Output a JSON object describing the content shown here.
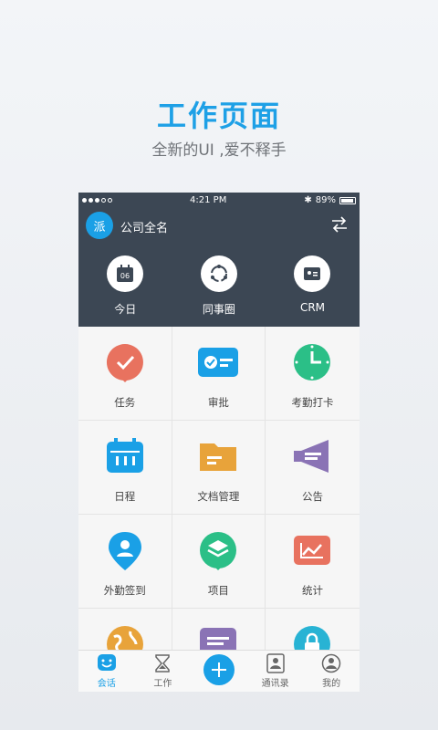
{
  "hero": {
    "title": "工作页面",
    "subtitle": "全新的UI ,爱不释手"
  },
  "status_bar": {
    "time": "4:21 PM",
    "battery": "89%"
  },
  "header": {
    "avatar_text": "派",
    "company": "公司全名"
  },
  "quick_actions": [
    {
      "label": "今日",
      "icon": "calendar-today-icon",
      "badge": "06"
    },
    {
      "label": "同事圈",
      "icon": "circle-refresh-icon"
    },
    {
      "label": "CRM",
      "icon": "contact-card-icon"
    }
  ],
  "grid": [
    {
      "label": "任务",
      "icon": "task-check-icon",
      "color": "#e8725f"
    },
    {
      "label": "审批",
      "icon": "approval-card-icon",
      "color": "#1aa0e6"
    },
    {
      "label": "考勤打卡",
      "icon": "clock-icon",
      "color": "#2bbf87"
    },
    {
      "label": "日程",
      "icon": "calendar-icon",
      "color": "#1aa0e6"
    },
    {
      "label": "文档管理",
      "icon": "folder-icon",
      "color": "#e8a33a"
    },
    {
      "label": "公告",
      "icon": "megaphone-icon",
      "color": "#8a73b5"
    },
    {
      "label": "外勤签到",
      "icon": "location-pin-icon",
      "color": "#1aa0e6"
    },
    {
      "label": "项目",
      "icon": "layers-icon",
      "color": "#2bbf87"
    },
    {
      "label": "统计",
      "icon": "chart-icon",
      "color": "#e8725f"
    },
    {
      "label": "",
      "icon": "globe-icon",
      "color": "#e8a33a"
    },
    {
      "label": "",
      "icon": "document-list-icon",
      "color": "#8a73b5"
    },
    {
      "label": "",
      "icon": "lock-icon",
      "color": "#28b3d4"
    }
  ],
  "tabs": [
    {
      "label": "会话",
      "icon": "chat-smile-icon",
      "active": true
    },
    {
      "label": "工作",
      "icon": "hourglass-icon",
      "active": false
    },
    {
      "label": "",
      "icon": "plus-icon",
      "active": false
    },
    {
      "label": "通讯录",
      "icon": "contacts-icon",
      "active": false
    },
    {
      "label": "我的",
      "icon": "profile-icon",
      "active": false
    }
  ]
}
